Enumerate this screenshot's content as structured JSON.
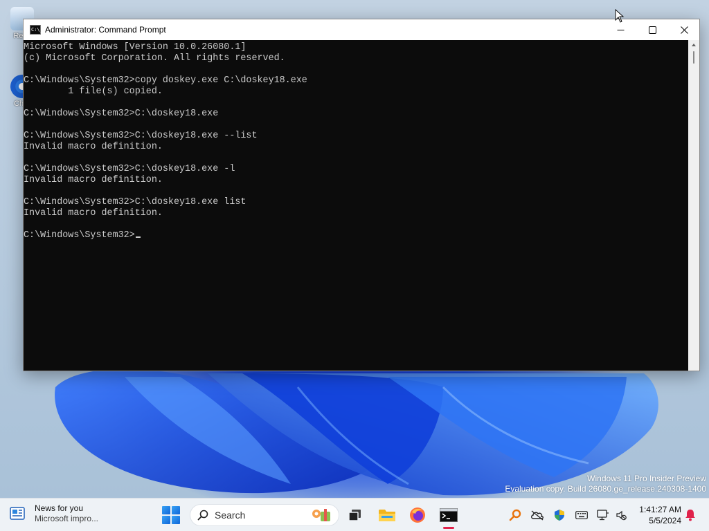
{
  "desktop": {
    "icons": [
      {
        "label": "Recy",
        "icon": "recycle-bin-icon"
      },
      {
        "label": "Chro",
        "icon": "chrome-shortcut-icon"
      }
    ],
    "watermark": {
      "line1": "Windows 11 Pro Insider Preview",
      "line2": "Evaluation copy. Build 26080.ge_release.240308-1400"
    }
  },
  "window": {
    "title": "Administrator: Command Prompt",
    "icon": "cmd-app-icon",
    "buttons": {
      "minimize": "—",
      "maximize": "☐",
      "close": "✕"
    },
    "console_lines": [
      "Microsoft Windows [Version 10.0.26080.1]",
      "(c) Microsoft Corporation. All rights reserved.",
      "",
      "C:\\Windows\\System32>copy doskey.exe C:\\doskey18.exe",
      "        1 file(s) copied.",
      "",
      "C:\\Windows\\System32>C:\\doskey18.exe",
      "",
      "C:\\Windows\\System32>C:\\doskey18.exe --list",
      "Invalid macro definition.",
      "",
      "C:\\Windows\\System32>C:\\doskey18.exe -l",
      "Invalid macro definition.",
      "",
      "C:\\Windows\\System32>C:\\doskey18.exe list",
      "Invalid macro definition.",
      "",
      "C:\\Windows\\System32>"
    ],
    "colors": {
      "background": "#0c0c0c",
      "foreground": "#cccccc"
    }
  },
  "taskbar": {
    "news": {
      "title": "News for you",
      "subtitle": "Microsoft impro..."
    },
    "search": {
      "label": "Search"
    },
    "apps": [
      "start-icon",
      "task-view-icon",
      "file-explorer-icon",
      "firefox-icon",
      "command-prompt-icon"
    ],
    "active_app": "command-prompt-icon",
    "tray_icons": [
      "magnifier-icon",
      "onedrive-offline-icon",
      "security-shield-icon",
      "keyboard-icon",
      "network-icon",
      "volume-muted-icon",
      "notification-bell-icon"
    ],
    "clock": {
      "time": "1:41:27 AM",
      "date": "5/5/2024"
    },
    "colors": {
      "accent": "#0f66d8",
      "active_indicator": "#e0224b"
    }
  }
}
